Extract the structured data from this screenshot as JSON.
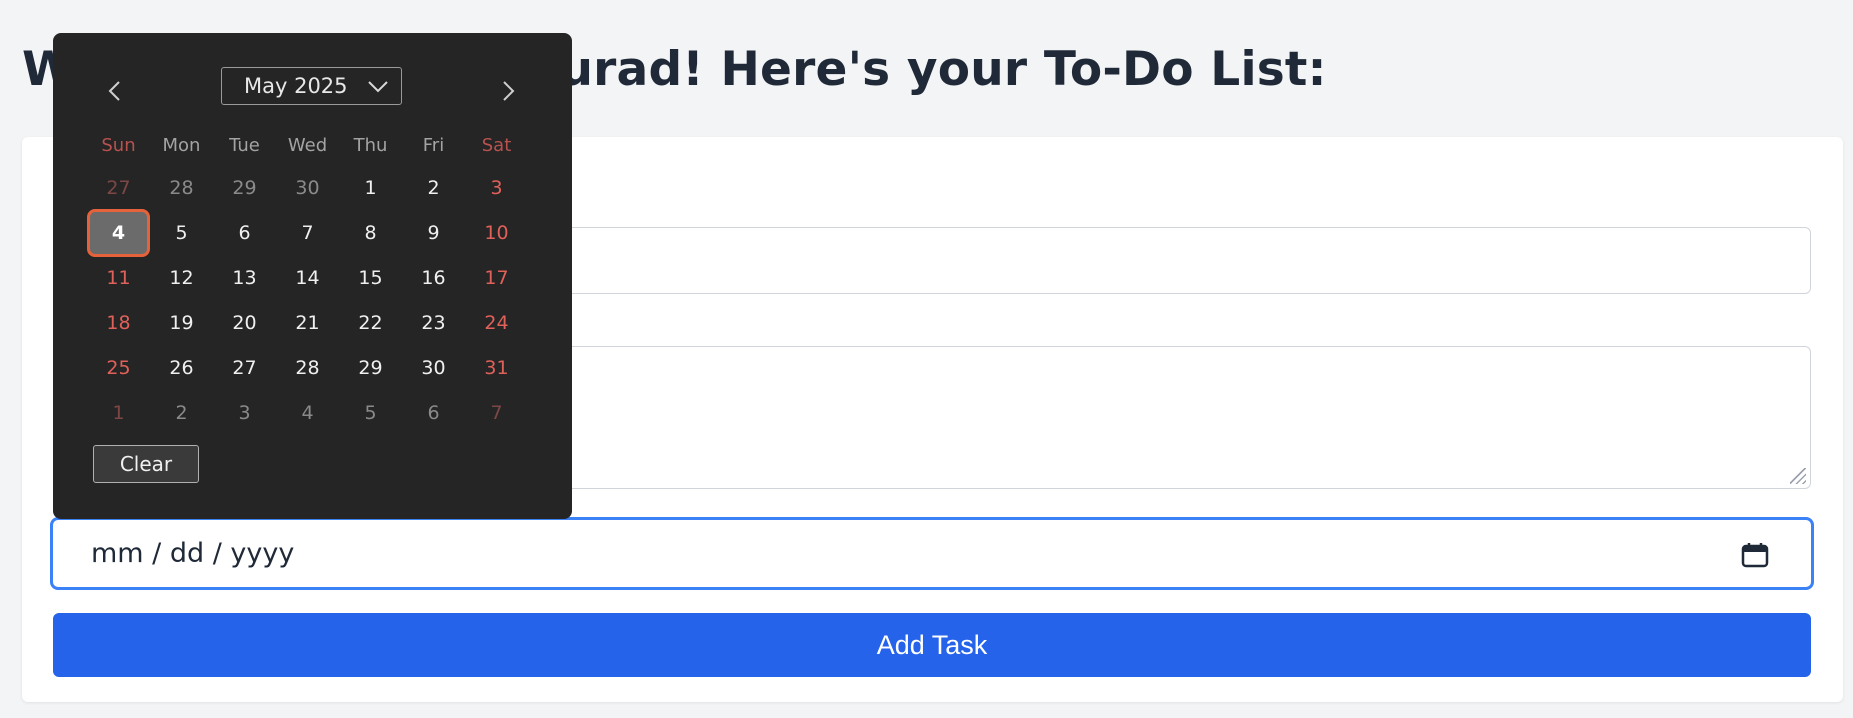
{
  "heading": {
    "text": "Welcome, ahmedmourad! Here's your To-Do List:"
  },
  "form": {
    "title_value": "",
    "description_value": "",
    "date_placeholder": "mm / dd / yyyy",
    "add_task_label": "Add Task"
  },
  "datepicker": {
    "month_label": "May 2025",
    "weekdays": [
      "Sun",
      "Mon",
      "Tue",
      "Wed",
      "Thu",
      "Fri",
      "Sat"
    ],
    "weeks": [
      [
        "27",
        "28",
        "29",
        "30",
        "1",
        "2",
        "3"
      ],
      [
        "4",
        "5",
        "6",
        "7",
        "8",
        "9",
        "10"
      ],
      [
        "11",
        "12",
        "13",
        "14",
        "15",
        "16",
        "17"
      ],
      [
        "18",
        "19",
        "20",
        "21",
        "22",
        "23",
        "24"
      ],
      [
        "25",
        "26",
        "27",
        "28",
        "29",
        "30",
        "31"
      ],
      [
        "1",
        "2",
        "3",
        "4",
        "5",
        "6",
        "7"
      ]
    ],
    "selected_day": "4",
    "clear_label": "Clear"
  },
  "icons": {
    "prev": "chevron-left-icon",
    "next": "chevron-right-icon",
    "month_dropdown": "chevron-down-icon",
    "calendar": "calendar-icon"
  },
  "colors": {
    "accent": "#2563eb",
    "focus_border": "#3b82f6",
    "weekend": "#e0605a",
    "selected_ring": "#e5623a",
    "picker_bg": "#252525"
  }
}
